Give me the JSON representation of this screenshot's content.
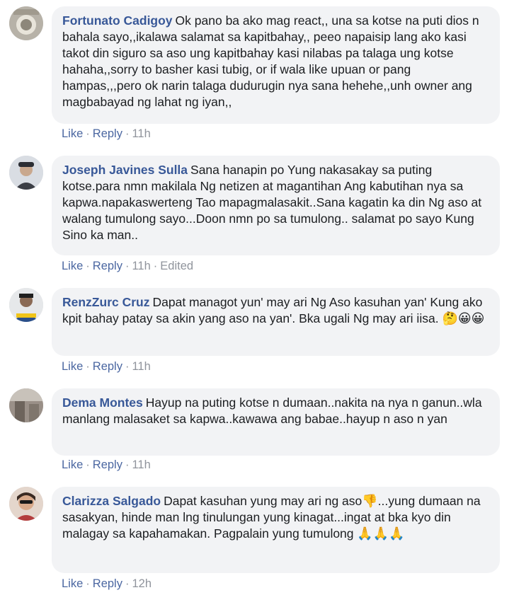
{
  "comments": [
    {
      "author": "Fortunato Cadigoy",
      "text": "Ok pano ba ako mag react,, una sa kotse na puti dios n bahala sayo,,ikalawa salamat sa kapitbahay,, peeo napaisip lang ako kasi takot din siguro sa aso ung kapitbahay kasi nilabas pa talaga ung kotse hahaha,,sorry to basher kasi tubig, or if wala like upuan or pang hampas,,,pero ok narin talaga dudurugin nya sana hehehe,,unh owner ang magbabayad ng lahat ng iyan,,",
      "like": "Like",
      "reply": "Reply",
      "time": "11h",
      "edited": ""
    },
    {
      "author": "Joseph Javines Sulla",
      "text": "Sana hanapin po Yung nakasakay sa puting kotse.para nmn makilala Ng netizen at magantihan Ang kabutihan nya sa kapwa.napakaswerteng Tao mapagmalasakit..Sana kagatin ka din Ng aso at walang tumulong sayo...Doon nmn po sa tumulong.. salamat po sayo Kung Sino ka man..",
      "like": "Like",
      "reply": "Reply",
      "time": "11h",
      "edited": "Edited"
    },
    {
      "author": "RenzZurc Cruz",
      "text": "Dapat managot yun' may ari Ng Aso kasuhan yan' Kung ako kpit bahay patay sa akin yang aso na yan'. Bka ugali Ng may ari iisa.",
      "emojis": "🤔😀😀",
      "like": "Like",
      "reply": "Reply",
      "time": "11h",
      "edited": ""
    },
    {
      "author": "Dema Montes",
      "text": "Hayup na puting kotse n dumaan..nakita na nya n ganun..wla manlang malasaket sa kapwa..kawawa ang babae..hayup n aso n yan",
      "like": "Like",
      "reply": "Reply",
      "time": "11h",
      "edited": ""
    },
    {
      "author": "Clarizza Salgado",
      "text": "Dapat kasuhan yung may ari ng aso",
      "emoji_inline": "👎",
      "text2": "...yung dumaan na sasakyan, hinde man lng tinulungan yung kinagat...ingat at bka kyo din malagay sa kapahamakan. Pagpalain yung tumulong",
      "emojis": "🙏🙏🙏",
      "like": "Like",
      "reply": "Reply",
      "time": "12h",
      "edited": ""
    }
  ],
  "separator": "·",
  "colors": {
    "author": "#385898",
    "bubble": "#f2f3f5",
    "action": "#4b67a1",
    "meta": "#90949c"
  }
}
